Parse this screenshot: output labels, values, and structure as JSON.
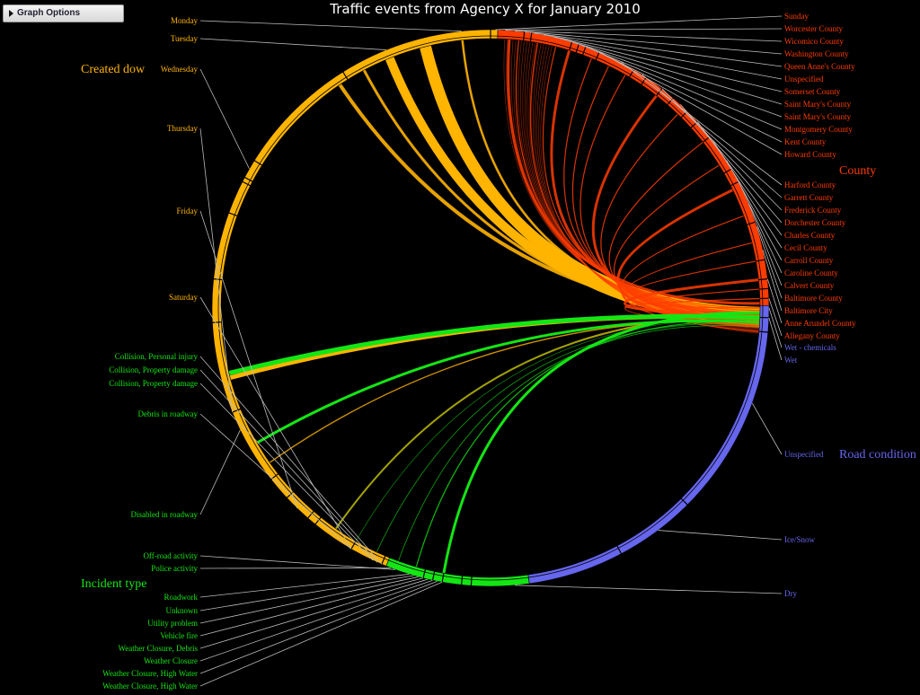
{
  "toolbar": {
    "options_label": "Graph Options"
  },
  "title": "Traffic events from Agency X for January 2010",
  "colors": {
    "created_dow": "#ffb400",
    "county": "#ff3c00",
    "road_condition": "#6666ee",
    "incident_type": "#14e614",
    "label_line": "#cccccc"
  },
  "groups": [
    {
      "id": "created_dow",
      "name": "Created dow",
      "color": "#ffb400",
      "labels": [
        "Monday",
        "Tuesday",
        "Wednesday",
        "Thursday",
        "Friday",
        "Saturday"
      ]
    },
    {
      "id": "county",
      "name": "County",
      "color": "#ff3c00",
      "labels": [
        "Sunday",
        "Worcester County",
        "Wicomico County",
        "Washington County",
        "Queen Anne's County",
        "Unspecified",
        "Somerset County",
        "Saint Mary's County",
        "Saint Mary's County",
        "Montgomery County",
        "Kent County",
        "Howard County",
        "Harford County",
        "Garrett County",
        "Frederick County",
        "Dorchester County",
        "Charles County",
        "Cecil County",
        "Carroll County",
        "Caroline County",
        "Calvert County",
        "Baltimore County",
        "Baltimore City",
        "Anne Arundel County",
        "Allegany County"
      ]
    },
    {
      "id": "road_condition",
      "name": "Road condition",
      "color": "#6666ee",
      "labels": [
        "Wet - chemicals",
        "Wet",
        "Unspecified",
        "Ice/Snow",
        "Dry"
      ]
    },
    {
      "id": "incident_type",
      "name": "Incident type",
      "color": "#14e614",
      "labels": [
        "Collision, Personal injury",
        "Collision, Property damage",
        "Collision, Property damage",
        "Debris in roadway",
        "Disabled in roadway",
        "Off-road activity",
        "Police activity",
        "Roadwork",
        "Unknown",
        "Utility problem",
        "Vehicle fire",
        "Weather Closure, Debris",
        "Weather Closure",
        "Weather Closure, High Water",
        "Weather Closure, High Water"
      ]
    }
  ]
}
